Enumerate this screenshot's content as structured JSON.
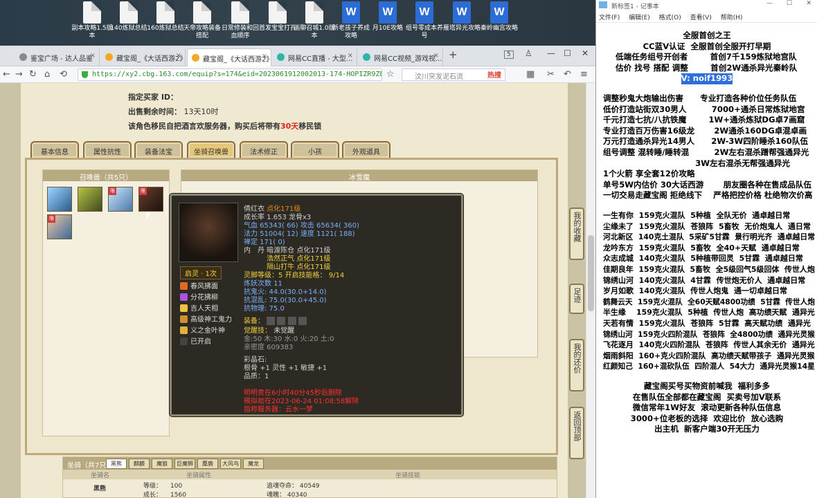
{
  "desktop": {
    "icons": [
      {
        "label": "副本攻略1.5版本",
        "kind": "doc"
      },
      {
        "label": "140炼狱总结",
        "kind": "doc"
      },
      {
        "label": "160炼狱总结",
        "kind": "doc"
      },
      {
        "label": "天帝攻略装备搭配",
        "kind": "doc"
      },
      {
        "label": "日常修装和回血顺序",
        "kind": "doc"
      },
      {
        "label": "首发宝宝打孔",
        "kind": "doc"
      },
      {
        "label": "画聊召城1.0版本",
        "kind": "doc"
      },
      {
        "label": "新老孩子养成攻略",
        "kind": "word"
      },
      {
        "label": "月10E攻略",
        "kind": "word"
      },
      {
        "label": "组号零成本养号",
        "kind": "word"
      },
      {
        "label": "雁塔异光攻略",
        "kind": "word"
      },
      {
        "label": "秦岭幽宫攻略",
        "kind": "word"
      }
    ]
  },
  "browser": {
    "tabs": [
      {
        "label": "鉴宝广场 - 达人品鉴"
      },
      {
        "label": "藏宝阁_《大话西游2》"
      },
      {
        "label": "藏宝阁_《大话西游2》"
      },
      {
        "label": "网易CC直播 - 大型..."
      },
      {
        "label": "网易CC视频_游戏视..."
      }
    ],
    "tab_count": "5",
    "url": "https://xy2.cbg.163.com/equip?s=174&eid=2023061912002013-174-HOPIZR9ZEFD",
    "search_placeholder": "汶川突发泥石流",
    "hot_label": "热搜"
  },
  "page": {
    "buyer_id_label": "指定买家 ID：",
    "remaining_label": "出售剩余时间：",
    "remaining_value": "13天10时",
    "migrate_text_1": "该角色移民自把酒言欢服务器，购买后将带有",
    "migrate_days": "30天",
    "migrate_text_2": "移民锁",
    "tabs": [
      "基本信息",
      "属性抗性",
      "装备法宝",
      "坐骑召唤兽",
      "法术修正",
      "小孩",
      "外观道具"
    ],
    "active_tab": "坐骑召唤兽",
    "pets_header": "召唤兽（共5只）",
    "detail_header": "冰雪魔",
    "limit_badge": "限",
    "side_buttons": [
      "我的收藏",
      "足迹",
      "我的还价",
      "返回顶部"
    ],
    "mounts_header": "坐骑（共7只）",
    "mount_tabs": [
      "黑熊",
      "麒麟",
      "魔狼",
      "巨魔狮",
      "麋鹿",
      "大风鸟",
      "魔龙"
    ],
    "mount_columns": [
      "坐骑名",
      "坐骑属性",
      "坐骑技能"
    ],
    "mount_row": {
      "name": "黑熊",
      "level_label": "等级：",
      "level": "100",
      "growth_label": "成长：",
      "growth": "1560",
      "life_label": "追魂夺命：",
      "life": "40549",
      "spirit_label": "魂魄：",
      "spirit": "40340"
    }
  },
  "tooltip": {
    "name": "倩红衣",
    "name_suffix": "点化171级",
    "growth": "成长率 1.653  龙骨x3",
    "hp": "气血 65343( 66) 攻击 65634( 360)",
    "mp": "法力 51004( 12) 速度 1121( 188)",
    "zen": "禅定 171( 0)",
    "inner_1": "内　丹 暗渡陈仓 点化171级",
    "inner_2": "　　　 浩然正气 点化171级",
    "inner_3": "　　　 隔山打牛 点化171级",
    "level_label": "灵脚等级：",
    "level_value": "5 开启技能格：",
    "level_slots": "9/14",
    "exp": "炼妖次数 11",
    "res_1": "抗鬼火: 44.0(30.0+14.0)",
    "res_2": "抗混乱: 75.0(30.0+45.0)",
    "res_3": "抗物理: 75.0",
    "equip_label": "装备：",
    "awake_label": "觉醒技：",
    "awake_value": "未觉醒",
    "elements": "金:50 木:30 水:0 火:20 土:0",
    "intimacy": "亲密度 609383",
    "stone_label": "彩晶石:",
    "stone_1": "根骨 +1 灵性 +1 敏捷 +1",
    "stone_2": "品质：1",
    "time_1": "明明贵在6小时40分45秒后删除",
    "time_2": "模拟劫在2023-06-24 01:08:58解除",
    "time_3": "指称服务器：云水一梦",
    "skill_header": "启灵 · 1次",
    "skills": [
      "春风拂面",
      "分花拂柳",
      "吉人天相",
      "高级神工鬼力",
      "义之金叶神",
      "已开启"
    ]
  },
  "notepad": {
    "title": "新标签1 - 记事本",
    "menu": [
      "文件(F)",
      "编辑(E)",
      "格式(O)",
      "查看(V)",
      "帮助(H)"
    ],
    "lines": [
      "全服首创之王",
      "CC蓝V认证  全服首创全服开打早期",
      "低端任务组号开创者        首创7千159炼狱地宫队",
      "估价 找号 搭配 调整        首创2W通杀异光秦岭队",
      "V: noif1993",
      "",
      "调整秒鬼大炮输出伤害      专业打造各种价位任务队伍",
      "低价打造站街双30男人         7000+通杀日常炼狱地宫",
      "千元打造七抗/八抗铁魔        1W+通杀炼狱DG卓7画窟",
      "专业打造百万伤害16级龙       2W通杀160DG卓混卓画",
      "万元打造通杀异光14男人      2W-3W四阶睡杀160队伍",
      "组号调整 混转睡/睡转混         2W左右混杀蹭帮强通异光",
      "                                 3W左右混杀无帮强通异光",
      "1个火箭 享全套12价攻略",
      "单号5W内估价 30大话西游       朋友圈各种在售成品队伍",
      "一切交易走藏宝阁 拒绝线下    严格把控价格 杜绝物次价高",
      "",
      "一生有你  159克火混队  5种植  全队无价  通卓越日常",
      "尘缘未了  159克火混队  苍狼阵  5畜牧  无价炮鬼人  通日常",
      "河北新区  140克土混队  5采矿5甘霖  景行明光齐  通卓越日常",
      "龙吟东方  159克火混队  5畜牧  全40+天赋  通卓越日常",
      "众志成城  140克火混队  5种植带回灵  5甘霖  通卓越日常",
      "佳期良年  159克火混队  5畜牧  全5级回气5级回体  传世人炮",
      "锦绣山河  140克火混队  4甘霖  传世炮无价人  通卓越日常",
      "岁月如歌  140克火混队  传世人炮鬼  通一切卓越日常",
      "鹤舞云天  159克火混队  全60天赋4800功绩  5甘霖  传世人炮",
      "半生缘    159克火混队  5种植  传世人炮  高功绩天赋  通异光",
      "天若有情  159克火混队  苍狼阵  5甘霖  高天赋功绩  通异光",
      "锦绣山河  159克火四阶混队  苍狼阵  全4800功绩  通异光灵猴",
      "飞花逐月  140克火四阶混队  苍狼阵  传世人其余无价  通异光",
      "烟雨斜阳  160+克火四阶混队  高功绩天赋带孩子  通异光灵猴",
      "红颜知己  160+混砍队伍  四阶混人  54大力  通异光灵猴14星",
      "",
      "藏宝阁买号买物资前喊我  福利多多",
      "在售队伍全部都在藏宝阁  买卖号加V联系",
      "微信常年1W好友  滚动更新各种队伍信息",
      "3000+位老板的选择  欢迎比价  放心选购",
      "出主机  新客户端30开无压力"
    ]
  },
  "colors": {
    "accent": "#2e6fd9",
    "gold": "#f0d040",
    "tooltip_bg": "#2c2a22",
    "page_bg": "#efe9d2"
  }
}
